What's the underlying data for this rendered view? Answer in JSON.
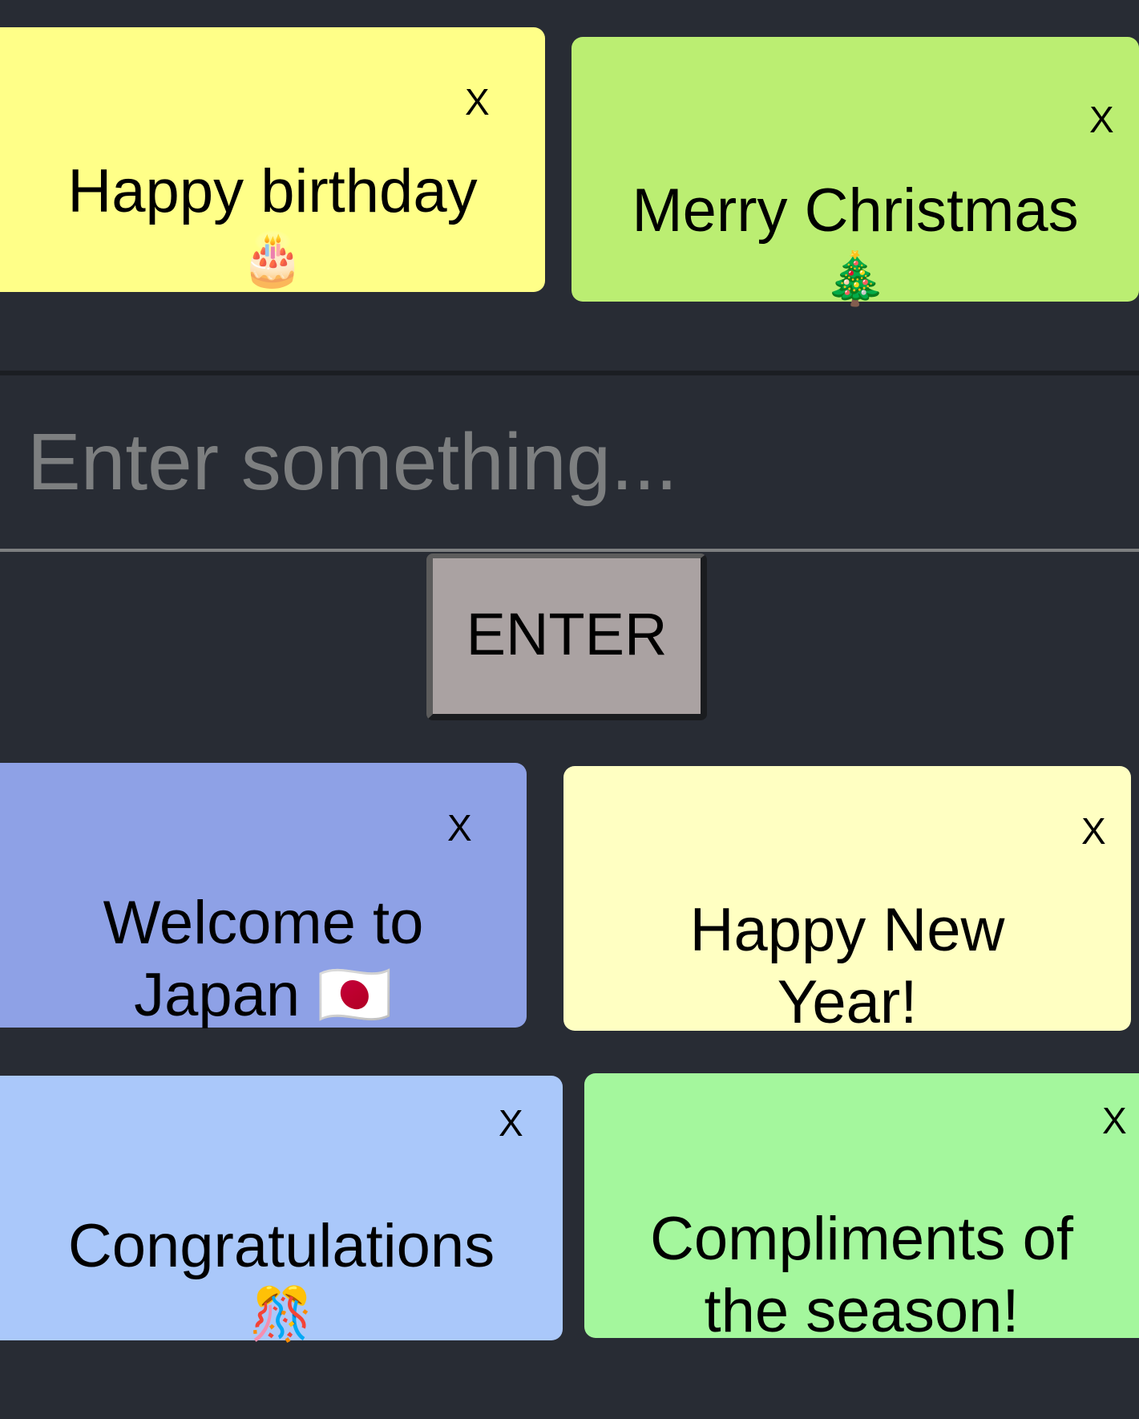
{
  "notes": [
    {
      "text": "Happy birthday",
      "emoji": "🎂",
      "color": "#ffff88",
      "close": "X"
    },
    {
      "text": "Merry Christmas",
      "emoji": "🎄",
      "color": "#bbee72",
      "close": "X"
    },
    {
      "text": "Welcome to\nJapan 🇯🇵",
      "emoji": "",
      "color": "#8ea1e6",
      "close": "X"
    },
    {
      "text": "Happy New\nYear!",
      "emoji": "",
      "color": "#ffffc2",
      "close": "X"
    },
    {
      "text": "Congratulations",
      "emoji": "🎊",
      "color": "#aac8fa",
      "close": "X"
    },
    {
      "text": "Compliments of\nthe season!",
      "emoji": "",
      "color": "#a4f79d",
      "close": "X"
    }
  ],
  "input": {
    "placeholder": "Enter something..."
  },
  "enter_button": {
    "label": "ENTER"
  },
  "colors": {
    "background": "#282c34",
    "button": "#aaa2a2"
  }
}
